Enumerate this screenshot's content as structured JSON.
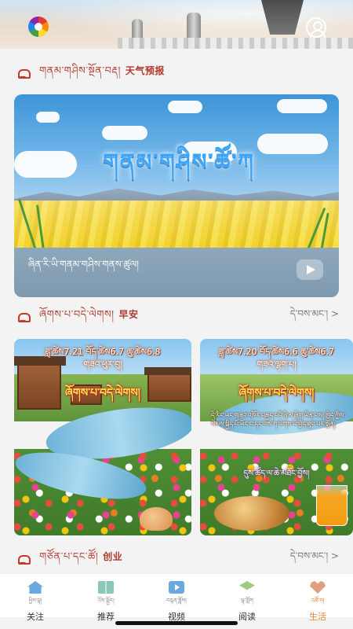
{
  "header": {
    "logo_icon": "app-logo-icon",
    "user_icon": "user-profile-icon"
  },
  "weather_section": {
    "title_tibetan": "གནམ་གཤིས་སྔོན་བརྡ།",
    "title_chinese": "天气预报",
    "card_title": "གནམ་གཤིས་ཚོ་ཀ",
    "card_caption": "ཞིན་རི་ཡི་གནམ་གཤིས་གནས་ཚུལ།"
  },
  "morning_section": {
    "title_tibetan": "ཞོགས་པ་བདེ་ལེགས།",
    "title_chinese": "早安",
    "more_label": "དེ་བས་མང་། >",
    "cards": [
      {
        "dateline": "ཟླ་ཚེས7.21 བོད་ཚེས6.7 ཆུ་ཚེས6.8",
        "subline": "གཟའ་ཕུར་བུ།",
        "greeting": "ཞོགས་པ་བདེ་ལེགས།"
      },
      {
        "dateline": "ཟླ་ཚེས7.20 བོད་ཚེས6.6 ཆུ་ཚེས6.7",
        "subline": "གཟའ་ལྷག་པ།",
        "greeting": "ཞོགས་པ་བདེ་ལེགས།",
        "body": "དེ་རིང་ཡང་གཟའ་འཁོར་བརྒྱད་པའི་ཉི་མ་ཞིག་ཡིན་པས། ཁྱེད་ཀྱིས་སེམས་སྐྱིད་པོ་ཡོང་བ་དང་ལས་ཀ་ལེགས་པོ་བྱེད་ཐུབ་པར་སྨོན།",
        "tagline": "དུས་ཚོད་ལ་ཆེ་མཐོང་བྱོས།"
      }
    ]
  },
  "business_section": {
    "title_tibetan": "གཙོན་པ་དང་ཚོ།",
    "title_chinese": "创业",
    "more_label": "དེ་བས་མང་། >"
  },
  "bottom_nav": [
    {
      "tibetan": "ཕྱིས་ལྟ།",
      "chinese": "关注",
      "icon": "home-icon"
    },
    {
      "tibetan": "འོས་སྦྱོར།",
      "chinese": "推荐",
      "icon": "book-icon"
    },
    {
      "tibetan": "བརྙན་ཟློས།",
      "chinese": "视频",
      "icon": "video-icon"
    },
    {
      "tibetan": "ལྟ་ཀློག",
      "chinese": "阅读",
      "icon": "graduation-cap-icon"
    },
    {
      "tibetan": "འཚོ་བ།",
      "chinese": "生活",
      "icon": "heart-hand-icon"
    }
  ],
  "colors": {
    "accent_red": "#b03a2e",
    "active_tab": "#e67e22",
    "sky_blue": "#3d95d8"
  }
}
